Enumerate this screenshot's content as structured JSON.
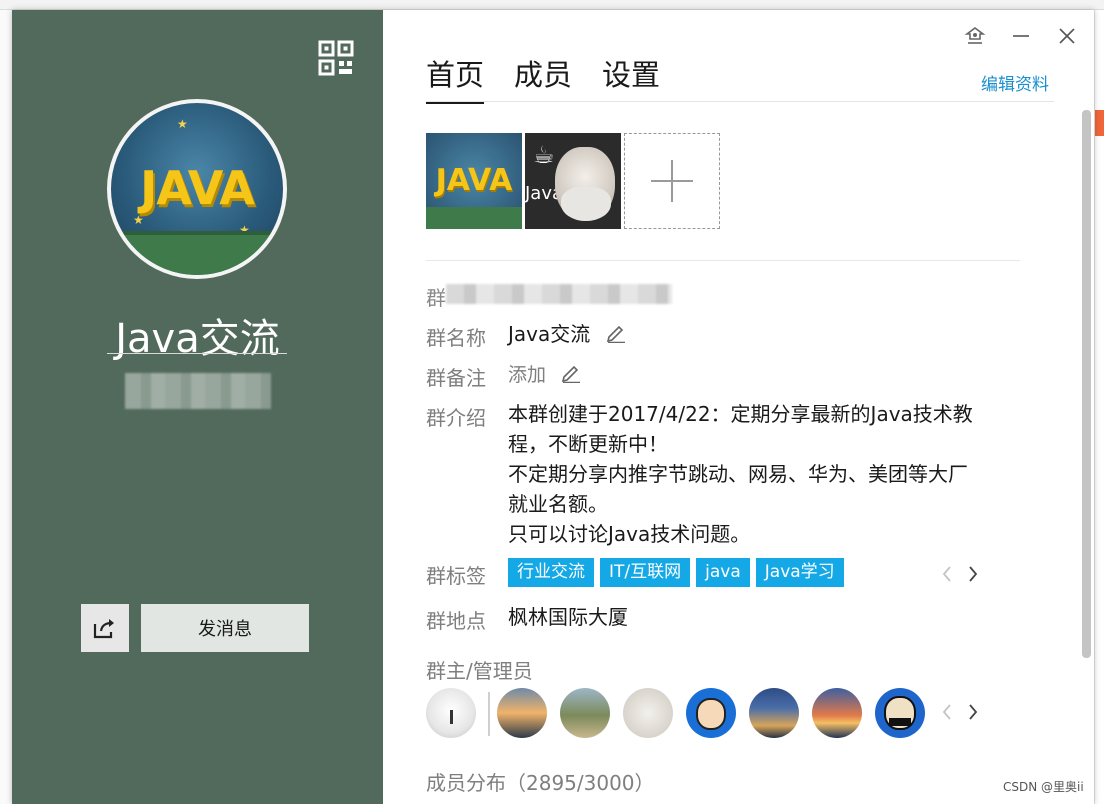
{
  "left": {
    "group_name": "Java交流",
    "avatar_logo": "JAVA",
    "send_message_label": "发消息"
  },
  "tabs": [
    "首页",
    "成员",
    "设置"
  ],
  "edit_profile_label": "编辑资料",
  "photos": {
    "photo1_logo": "JAVA",
    "photo2_text": "Java"
  },
  "info": {
    "blurred_label": "群",
    "name_label": "群名称",
    "name_value": "Java交流",
    "remark_label": "群备注",
    "remark_value": "添加",
    "intro_label": "群介绍",
    "intro_lines": [
      "本群创建于2017/4/22：定期分享最新的Java技术教",
      "程，不断更新中！",
      "不定期分享内推字节跳动、网易、华为、美团等大厂",
      "就业名额。",
      "只可以讨论Java技术问题。"
    ],
    "tags_label": "群标签",
    "tags": [
      "行业交流",
      "IT/互联网",
      "java",
      "Java学习"
    ],
    "location_label": "群地点",
    "location_value": "枫林国际大厦"
  },
  "admin_title": "群主/管理员",
  "member_distribution": "成员分布（2895/3000）",
  "watermark": "CSDN @里奥ii",
  "colors": {
    "left_panel": "#526a5b",
    "tag_bg": "#14a9e6",
    "link": "#1a8fd0"
  }
}
